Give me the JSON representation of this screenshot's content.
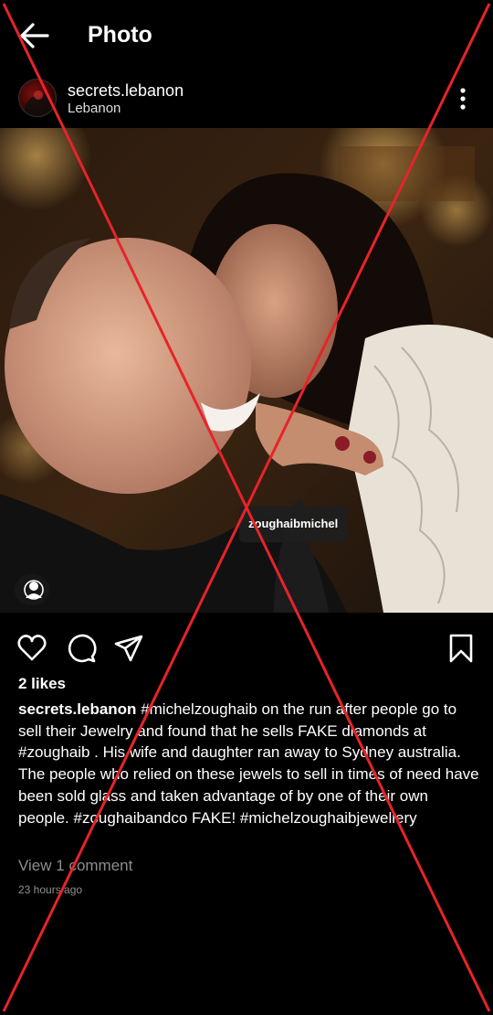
{
  "header": {
    "title": "Photo",
    "back_icon": "arrow-left-icon"
  },
  "post": {
    "username": "secrets.lebanon",
    "location": "Lebanon",
    "more_icon": "vertical-dots-icon",
    "photo": {
      "tag_label": "zoughaibmichel",
      "user_tag_icon": "person-tag-icon"
    },
    "actions": {
      "like_icon": "heart-icon",
      "comment_icon": "comment-bubble-icon",
      "share_icon": "paper-plane-icon",
      "save_icon": "bookmark-icon"
    },
    "likes": "2 likes",
    "caption_username": "secrets.lebanon",
    "caption_text": "#michelzoughaib on the run after people go to sell their Jewelry and found that he sells FAKE diamonds at #zoughaib . His wife and daughter ran away to Sydney australia. The people who relied on these jewels to sell in times of need have been sold glass and taken advantage of by one of their own people. #zoughaibandco FAKE! #michelzoughaibjewellery",
    "view_comments": "View 1 comment",
    "timestamp": "23 hours ago"
  },
  "overlay": {
    "mark": "red-x-cross",
    "color": "#e8232a"
  }
}
